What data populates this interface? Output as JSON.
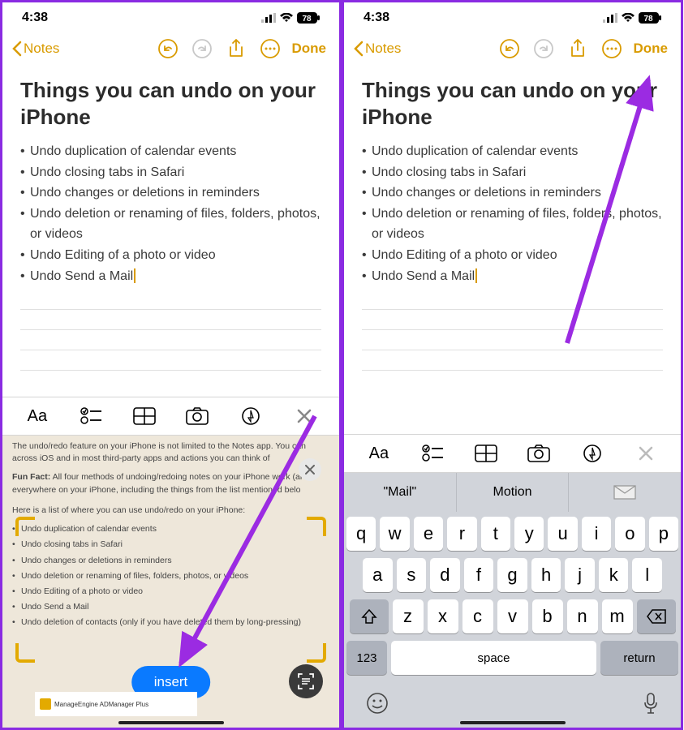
{
  "status": {
    "time": "4:38",
    "battery": "78"
  },
  "nav": {
    "back": "Notes",
    "done": "Done"
  },
  "note": {
    "title": "Things you can undo on your iPhone",
    "bullets": [
      "Undo duplication of calendar events",
      "Undo closing tabs in Safari",
      "Undo changes or deletions in reminders",
      "Undo deletion or renaming of files, folders, photos, or videos",
      "Undo Editing of a photo or video",
      "Undo Send a Mail"
    ]
  },
  "scan": {
    "intro": "The undo/redo feature on your iPhone is not limited to the Notes app. You can across iOS and in most third-party apps and actions you can think of",
    "funfact_label": "Fun Fact:",
    "funfact": "All four methods of undoing/redoing notes on your iPhone work (al everywhere on your iPhone, including the things from the list mentioned belo",
    "list_intro": "Here is a list of where you can use undo/redo on your iPhone:",
    "bullets": [
      "Undo duplication of calendar events",
      "Undo closing tabs in Safari",
      "Undo changes or deletions in reminders",
      "Undo deletion or renaming of files, folders, photos, or videos",
      "Undo Editing of a photo or video",
      "Undo Send a Mail",
      "Undo deletion of contacts (only if you have deleted them by long-pressing)"
    ],
    "insert": "insert",
    "ad": "ManageEngine ADManager Plus"
  },
  "keyboard": {
    "suggestions": [
      "\"Mail\"",
      "Motion"
    ],
    "row1": [
      "q",
      "w",
      "e",
      "r",
      "t",
      "y",
      "u",
      "i",
      "o",
      "p"
    ],
    "row2": [
      "a",
      "s",
      "d",
      "f",
      "g",
      "h",
      "j",
      "k",
      "l"
    ],
    "row3": [
      "z",
      "x",
      "c",
      "v",
      "b",
      "n",
      "m"
    ],
    "k123": "123",
    "space": "space",
    "return": "return"
  },
  "format_bar": {
    "aa": "Aa"
  }
}
